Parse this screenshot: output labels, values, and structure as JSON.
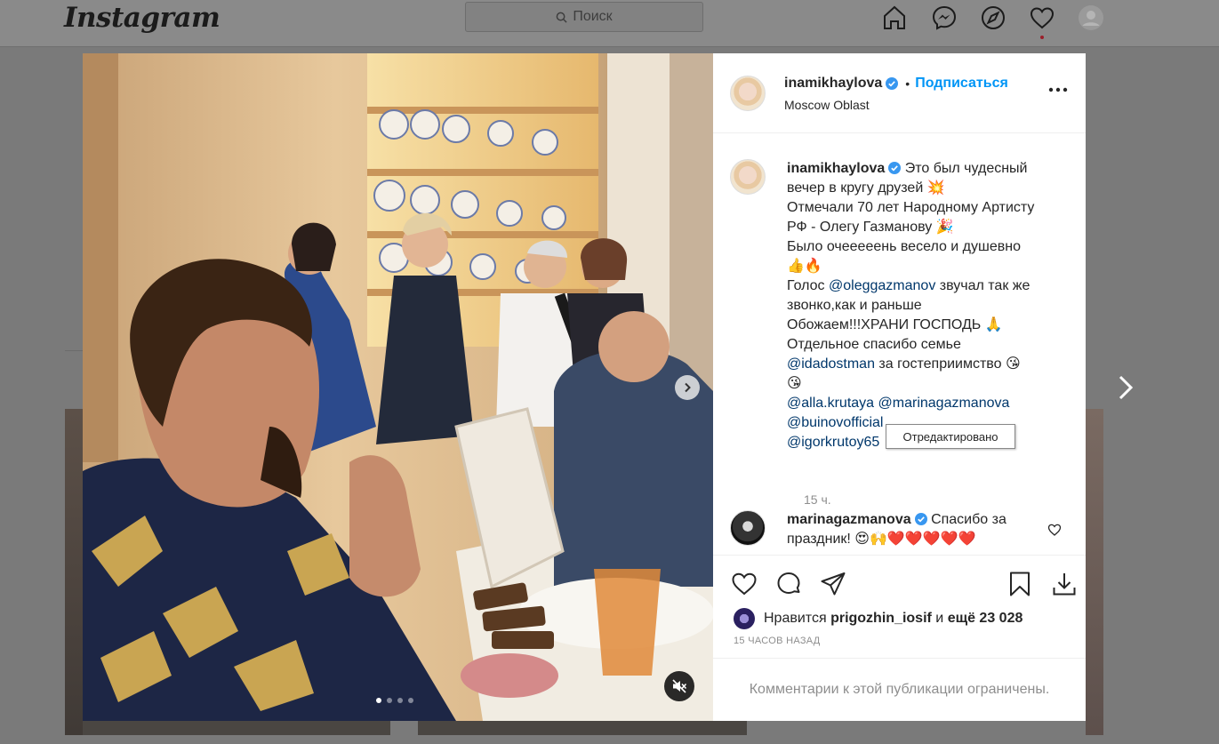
{
  "topbar": {
    "logo": "Instagram",
    "search_placeholder": "Поиск"
  },
  "post": {
    "author": "inamikhaylova",
    "follow_label": "Подписаться",
    "location": "Moscow Oblast",
    "caption_lines": [
      "Это был чудесный",
      "вечер в кругу друзей 💥",
      "Отмечали 70 лет Народному Артисту",
      "РФ - Олегу Газманову 🎉",
      "Было очееееень весело и душевно",
      "👍🔥",
      "Голос",
      "звучал так же",
      "звонко,как и раньше",
      "Обожаем!!!ХРАНИ ГОСПОДЬ 🙏",
      "Отдельное спасибо семье",
      "за гостеприимство 😘",
      "😘"
    ],
    "mentions": [
      "@oleggazmanov",
      "@idadostman",
      "@alla.krutaya",
      "@marinagazmanova",
      "@buinovofficial",
      "@igorkrutoy65"
    ],
    "caption_time": "15 ч.",
    "tooltip": "Отредактировано",
    "reply": {
      "author": "marinagazmanova",
      "text": "Спасибо за",
      "text2": "праздник! 😍🙌❤️❤️❤️❤️❤️"
    },
    "likes": {
      "prefix": "Нравится",
      "user": "prigozhin_iosif",
      "joiner": "и",
      "others": "ещё 23 028"
    },
    "posted_ago": "15 ЧАСОВ НАЗАД",
    "comments_limited": "Комментарии к этой публикации ограничены.",
    "carousel": {
      "count": 4,
      "active_index": 0
    }
  },
  "icons": {
    "nav": [
      "home-icon",
      "messenger-icon",
      "explore-icon",
      "heart-icon",
      "profile-avatar"
    ],
    "actions": [
      "like-icon",
      "comment-icon",
      "share-icon",
      "save-icon",
      "download-icon"
    ]
  },
  "colors": {
    "link": "#0095f6",
    "mention": "#00376b",
    "verified": "#3897f0",
    "muted_text": "#8e8e8e"
  }
}
